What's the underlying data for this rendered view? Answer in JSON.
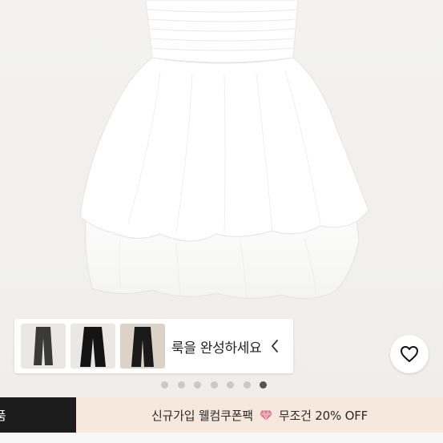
{
  "look": {
    "label": "룩을 완성하세요",
    "thumbs": [
      "wide-leg-pants-beige",
      "wide-leg-pants-black",
      "wide-leg-pants-black-2"
    ]
  },
  "pager": {
    "count": 7,
    "active_index": 6
  },
  "bottom": {
    "left_label": "품",
    "promo_part1": "신규가입 웰컴쿠폰팩",
    "promo_part2": "무조건 20% OFF"
  },
  "colors": {
    "dark": "#1c1c1c",
    "promo_bg": "#f6e8dc",
    "dot": "#c9c9c9",
    "dot_active": "#555555"
  },
  "icons": [
    "heart-outline-icon",
    "chevron-left-icon",
    "heart-gem-icon"
  ]
}
